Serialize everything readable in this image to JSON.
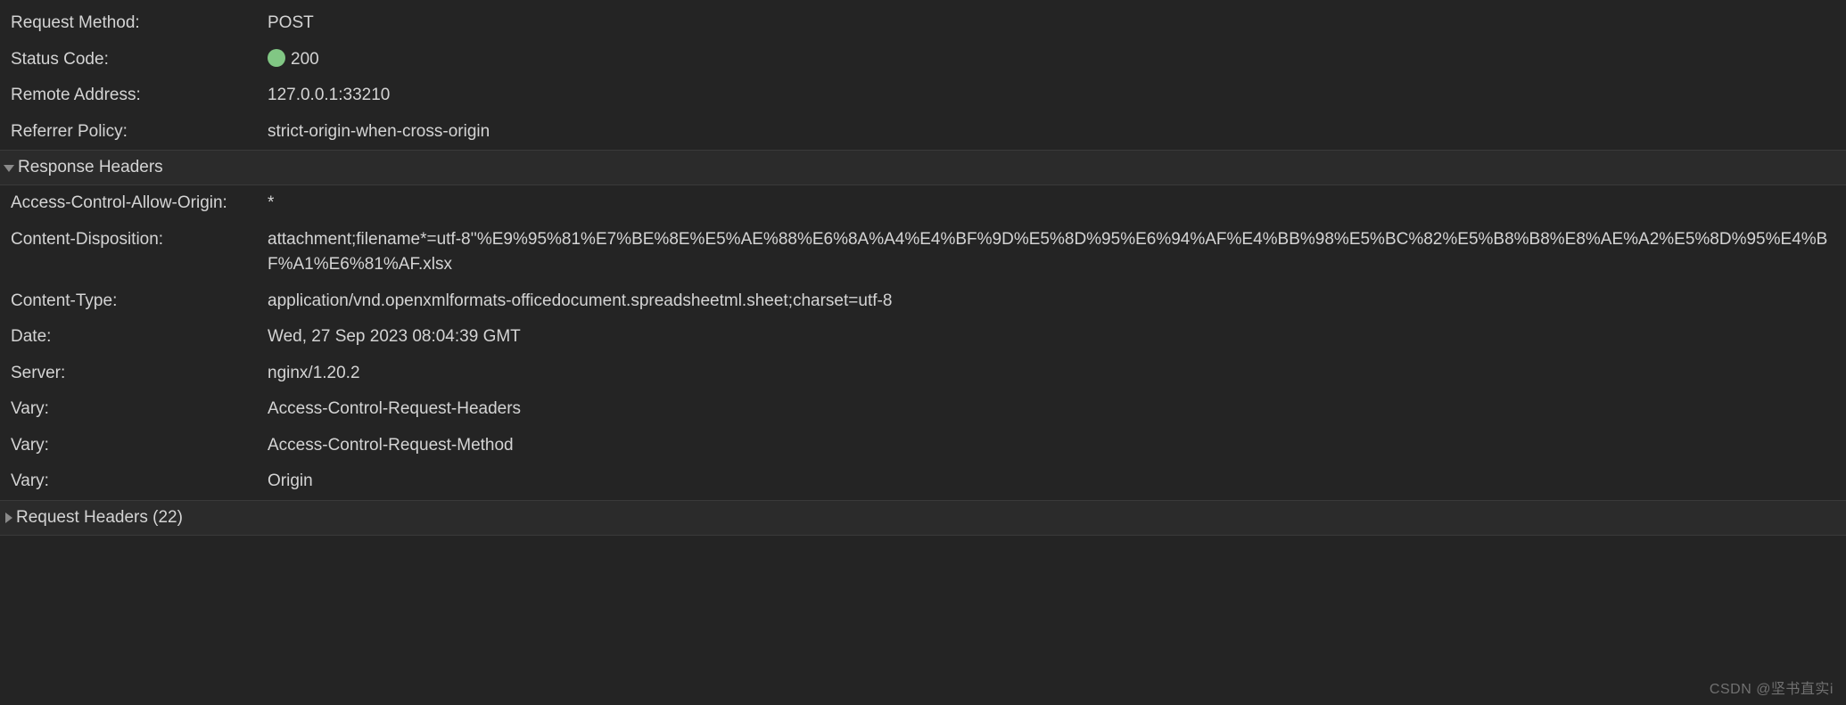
{
  "general": {
    "requestMethod": {
      "label": "Request Method:",
      "value": "POST"
    },
    "statusCode": {
      "label": "Status Code:",
      "value": "200"
    },
    "remoteAddress": {
      "label": "Remote Address:",
      "value": "127.0.0.1:33210"
    },
    "referrerPolicy": {
      "label": "Referrer Policy:",
      "value": "strict-origin-when-cross-origin"
    }
  },
  "responseHeaders": {
    "title": "Response Headers",
    "items": [
      {
        "label": "Access-Control-Allow-Origin:",
        "value": "*"
      },
      {
        "label": "Content-Disposition:",
        "value": "attachment;filename*=utf-8''%E9%95%81%E7%BE%8E%E5%AE%88%E6%8A%A4%E4%BF%9D%E5%8D%95%E6%94%AF%E4%BB%98%E5%BC%82%E5%B8%B8%E8%AE%A2%E5%8D%95%E4%BF%A1%E6%81%AF.xlsx"
      },
      {
        "label": "Content-Type:",
        "value": "application/vnd.openxmlformats-officedocument.spreadsheetml.sheet;charset=utf-8"
      },
      {
        "label": "Date:",
        "value": "Wed, 27 Sep 2023 08:04:39 GMT"
      },
      {
        "label": "Server:",
        "value": "nginx/1.20.2"
      },
      {
        "label": "Vary:",
        "value": "Access-Control-Request-Headers"
      },
      {
        "label": "Vary:",
        "value": "Access-Control-Request-Method"
      },
      {
        "label": "Vary:",
        "value": "Origin"
      }
    ]
  },
  "requestHeaders": {
    "title": "Request Headers (22)"
  },
  "watermark": "CSDN @坚书直实i"
}
